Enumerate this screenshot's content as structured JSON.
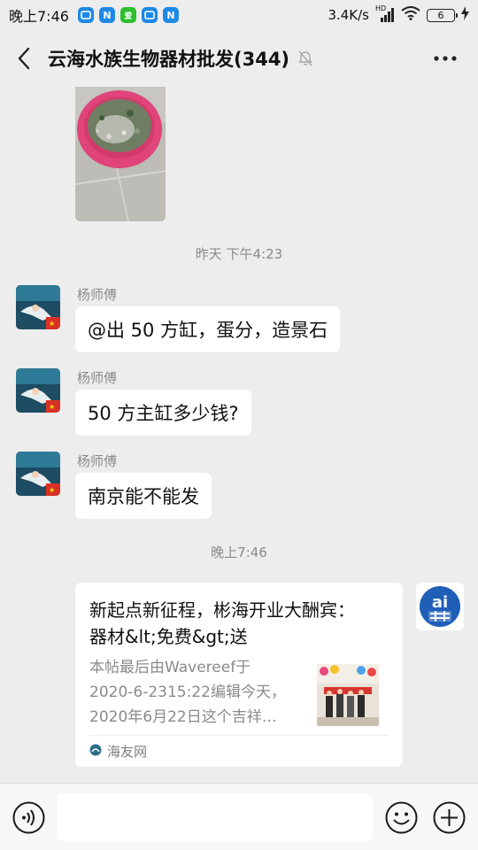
{
  "status_bar": {
    "time": "晚上7:46",
    "network_speed": "3.4K/s",
    "hd_label": "HD",
    "battery": "6",
    "app_icons": [
      {
        "name": "app-1-icon",
        "color": "#1e88e5",
        "glyph": ""
      },
      {
        "name": "app-2-icon",
        "color": "#1e88e5",
        "glyph": "N"
      },
      {
        "name": "app-3-icon",
        "color": "#2dbe2d",
        "glyph": "爱"
      },
      {
        "name": "app-4-icon",
        "color": "#1e88e5",
        "glyph": ""
      },
      {
        "name": "app-5-icon",
        "color": "#1e88e5",
        "glyph": "N"
      }
    ]
  },
  "header": {
    "title": "云海水族生物器材批发(344)"
  },
  "messages": {
    "timestamp_1": "昨天 下午4:23",
    "msg_1": {
      "sender": "杨师傅",
      "text": "@出 50 方缸，蛋分，造景石"
    },
    "msg_2": {
      "sender": "杨师傅",
      "text": "50 方主缸多少钱?"
    },
    "msg_3": {
      "sender": "杨师傅",
      "text": "南京能不能发"
    },
    "timestamp_2": "晚上7:46"
  },
  "card": {
    "title_line1": "新起点新征程，彬海开业大酬宾：",
    "title_line2": "器材&lt;免费&gt;送",
    "desc_line1": "本帖最后由Wavereef于",
    "desc_line2": "2020-6-2315:22编辑今天，",
    "desc_line3": "2020年6月22日这个吉祥…",
    "source": "海友网",
    "avatar_text": "ai"
  },
  "input": {
    "placeholder": ""
  },
  "colors": {
    "background": "#ededed",
    "bubble": "#ffffff",
    "muted_text": "#8a8a8a",
    "input_bar": "#f7f7f7"
  }
}
